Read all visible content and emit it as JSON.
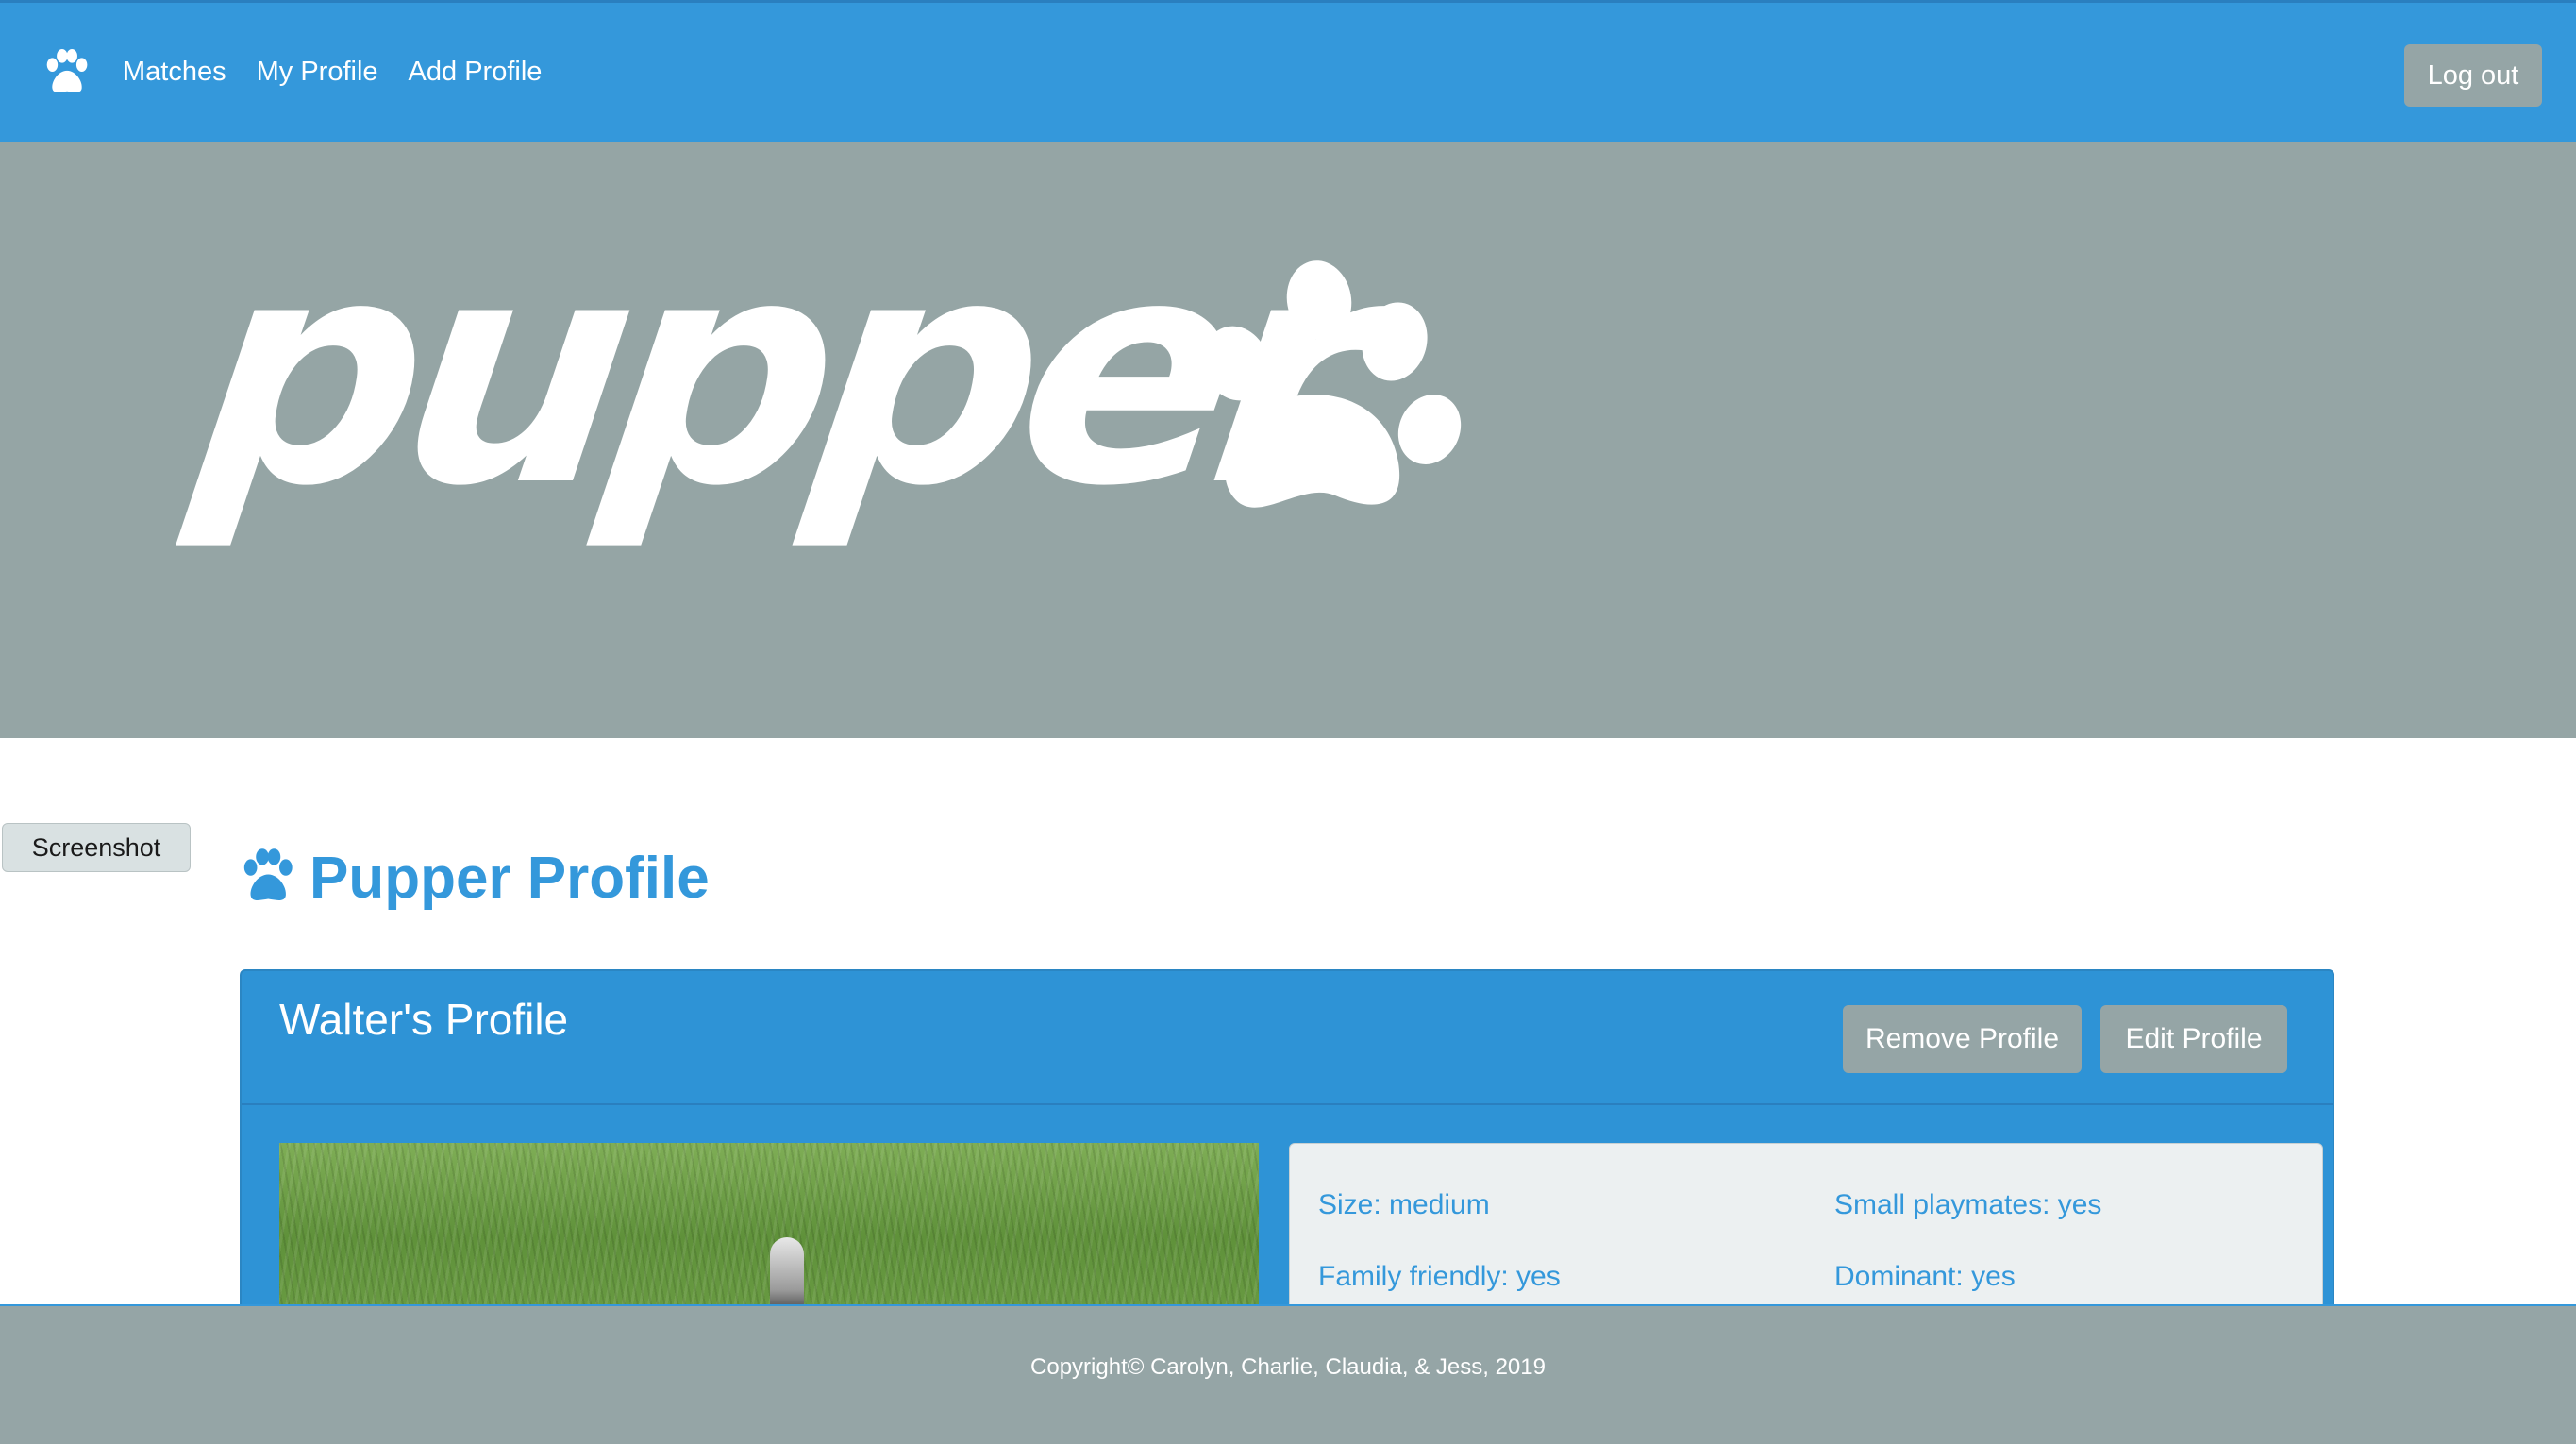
{
  "navbar": {
    "brand_icon": "paw-icon",
    "links": [
      "Matches",
      "My Profile",
      "Add Profile"
    ],
    "logout_label": "Log out"
  },
  "hero": {
    "logo_text": "pupper",
    "logo_icon": "paw-icon",
    "screenshot_label": "Screenshot"
  },
  "main": {
    "title_icon": "paw-icon",
    "title": "Pupper Profile",
    "card": {
      "title": "Walter's Profile",
      "remove_label": "Remove Profile",
      "edit_label": "Edit Profile",
      "details": [
        "Size: medium",
        "Small playmates: yes",
        "Family friendly: yes",
        "Dominant: yes"
      ]
    }
  },
  "footer": {
    "copyright": "Copyright©  Carolyn, Charlie, Claudia, & Jess, 2019"
  },
  "colors": {
    "primary": "#3498db",
    "muted": "#95a5a6",
    "panel": "#ecf0f1",
    "white": "#ffffff"
  }
}
